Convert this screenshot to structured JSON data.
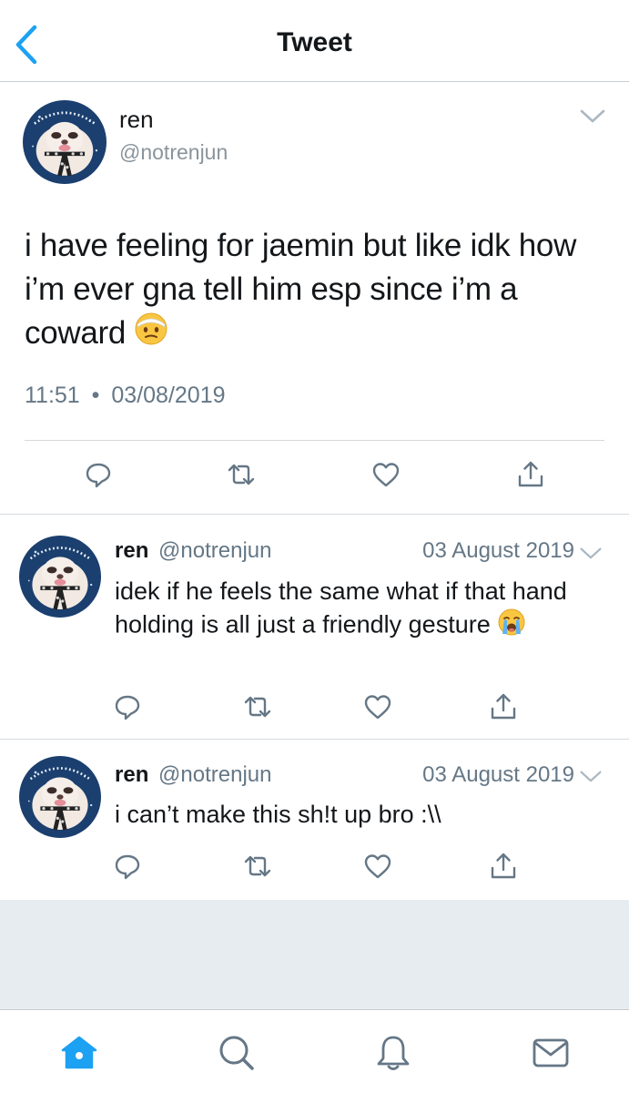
{
  "nav": {
    "title": "Tweet",
    "back_icon": "chevron-left-icon"
  },
  "colors": {
    "accent": "#1da1f2",
    "secondary_text": "#657786",
    "divider": "#d6dadd",
    "background_gray": "#e6ecf0"
  },
  "main_tweet": {
    "name": "ren",
    "handle": "@notrenjun",
    "text": "i have feeling for jaemin but like idk how i’m ever gna tell him esp since i’m a coward",
    "emoji": "face-with-head-bandage",
    "time": "11:51",
    "date": "03/08/2019",
    "separator": "•",
    "actions": [
      "reply-icon",
      "retweet-icon",
      "like-icon",
      "share-icon"
    ]
  },
  "replies": [
    {
      "name": "ren",
      "handle": "@notrenjun",
      "date": "03 August 2019",
      "text": "idek if he feels the same what if that hand holding is all just a friendly gesture",
      "emoji": "loudly-crying-face"
    },
    {
      "name": "ren",
      "handle": "@notrenjun",
      "date": "03 August 2019",
      "text": "i can’t make this sh!t up bro :\\\\"
    }
  ],
  "tabbar": {
    "items": [
      {
        "icon": "home-icon",
        "active": true
      },
      {
        "icon": "search-icon",
        "active": false
      },
      {
        "icon": "notifications-icon",
        "active": false
      },
      {
        "icon": "messages-icon",
        "active": false
      }
    ]
  }
}
